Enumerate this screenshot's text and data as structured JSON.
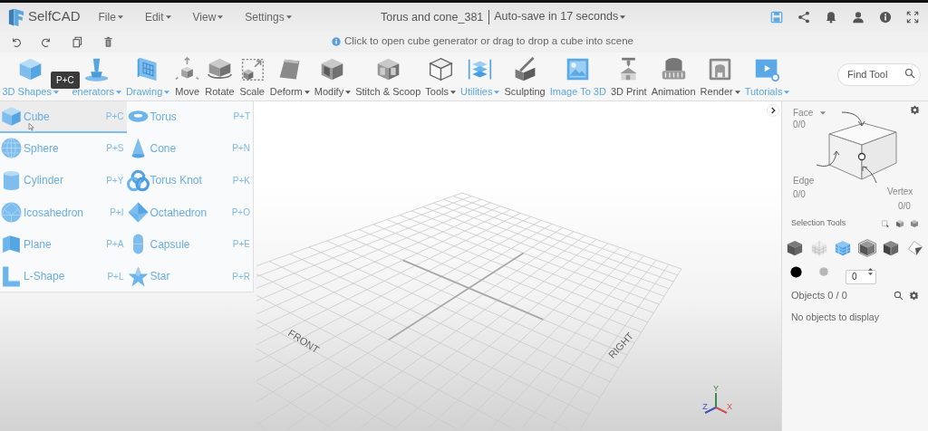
{
  "app": {
    "logo": "SelfCAD",
    "menus": [
      {
        "label": "File"
      },
      {
        "label": "Edit"
      },
      {
        "label": "View"
      },
      {
        "label": "Settings"
      }
    ],
    "document_title": "Torus and cone_381",
    "autosave": "Auto-save in 17 seconds"
  },
  "hint": "Click to open cube generator or drag to drop a cube into scene",
  "toolbar": {
    "tools": [
      {
        "label": "3D Shapes",
        "highlighted": true,
        "dropdown": true
      },
      {
        "label": "enerators",
        "highlighted": true,
        "dropdown": true
      },
      {
        "label": "Drawing",
        "highlighted": true,
        "dropdown": true
      },
      {
        "label": "Move",
        "highlighted": false,
        "dropdown": false
      },
      {
        "label": "Rotate",
        "highlighted": false,
        "dropdown": false
      },
      {
        "label": "Scale",
        "highlighted": false,
        "dropdown": false
      },
      {
        "label": "Deform",
        "highlighted": false,
        "dropdown": true
      },
      {
        "label": "Modify",
        "highlighted": false,
        "dropdown": true
      },
      {
        "label": "Stitch & Scoop",
        "highlighted": false,
        "dropdown": false
      },
      {
        "label": "Tools",
        "highlighted": false,
        "dropdown": true
      },
      {
        "label": "Utilities",
        "highlighted": true,
        "dropdown": true
      },
      {
        "label": "Sculpting",
        "highlighted": false,
        "dropdown": false
      },
      {
        "label": "Image To 3D",
        "highlighted": true,
        "dropdown": false
      },
      {
        "label": "3D Print",
        "highlighted": false,
        "dropdown": false
      },
      {
        "label": "Animation",
        "highlighted": false,
        "dropdown": false
      },
      {
        "label": "Render",
        "highlighted": false,
        "dropdown": true
      },
      {
        "label": "Tutorials",
        "highlighted": true,
        "dropdown": true
      }
    ],
    "tooltip": "P+C",
    "search": {
      "placeholder": "Find Tool"
    }
  },
  "shapes_menu": [
    {
      "name": "Cube",
      "shortcut": "P+C",
      "selected": true
    },
    {
      "name": "Torus",
      "shortcut": "P+T",
      "selected": false
    },
    {
      "name": "Sphere",
      "shortcut": "P+S",
      "selected": false
    },
    {
      "name": "Cone",
      "shortcut": "P+N",
      "selected": false
    },
    {
      "name": "Cylinder",
      "shortcut": "P+Y",
      "selected": false
    },
    {
      "name": "Torus Knot",
      "shortcut": "P+K",
      "selected": false
    },
    {
      "name": "Icosahedron",
      "shortcut": "P+I",
      "selected": false
    },
    {
      "name": "Octahedron",
      "shortcut": "P+O",
      "selected": false
    },
    {
      "name": "Plane",
      "shortcut": "P+A",
      "selected": false
    },
    {
      "name": "Capsule",
      "shortcut": "P+E",
      "selected": false
    },
    {
      "name": "L-Shape",
      "shortcut": "P+L",
      "selected": false
    },
    {
      "name": "Star",
      "shortcut": "P+R",
      "selected": false
    }
  ],
  "viewport": {
    "axis_labels": [
      "FRONT",
      "RIGHT"
    ],
    "gizmo": [
      "X",
      "Y",
      "Z"
    ]
  },
  "panel": {
    "face": {
      "label": "Face",
      "count": "0/0"
    },
    "edge": {
      "label": "Edge",
      "count": "0/0"
    },
    "vertex": {
      "label": "Vertex",
      "count": "0/0"
    },
    "selection_tools": "Selection Tools",
    "selection_modes": [
      {
        "selected": false
      },
      {
        "selected": false
      },
      {
        "selected": true
      },
      {
        "selected": false
      },
      {
        "selected": false
      },
      {
        "selected": false
      }
    ],
    "point_size": "0",
    "objects": "Objects 0 / 0",
    "empty": "No objects to display"
  }
}
